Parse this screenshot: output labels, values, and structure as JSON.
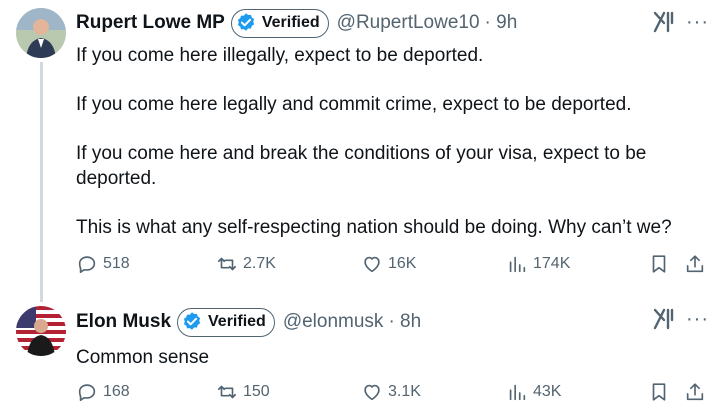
{
  "tweets": [
    {
      "author": {
        "name": "Rupert Lowe MP",
        "verified_label": "Verified",
        "handle": "@RupertLowe10",
        "time": "· 9h"
      },
      "paragraphs": [
        "If you come here illegally, expect to be deported.",
        "If you come here legally and commit crime, expect to be deported.",
        "If you come here and break the conditions of your visa, expect to be deported.",
        "This is what any self-respecting nation should be doing. Why can’t we?"
      ],
      "stats": {
        "replies": "518",
        "retweets": "2.7K",
        "likes": "16K",
        "views": "174K"
      }
    },
    {
      "author": {
        "name": "Elon Musk",
        "verified_label": "Verified",
        "handle": "@elonmusk",
        "time": "· 8h"
      },
      "paragraphs": [
        "Common sense"
      ],
      "stats": {
        "replies": "168",
        "retweets": "150",
        "likes": "3.1K",
        "views": "43K"
      }
    }
  ],
  "ui": {
    "more_glyph": "···",
    "verified_color": "#1d9bf0",
    "icon_color": "#536471"
  }
}
